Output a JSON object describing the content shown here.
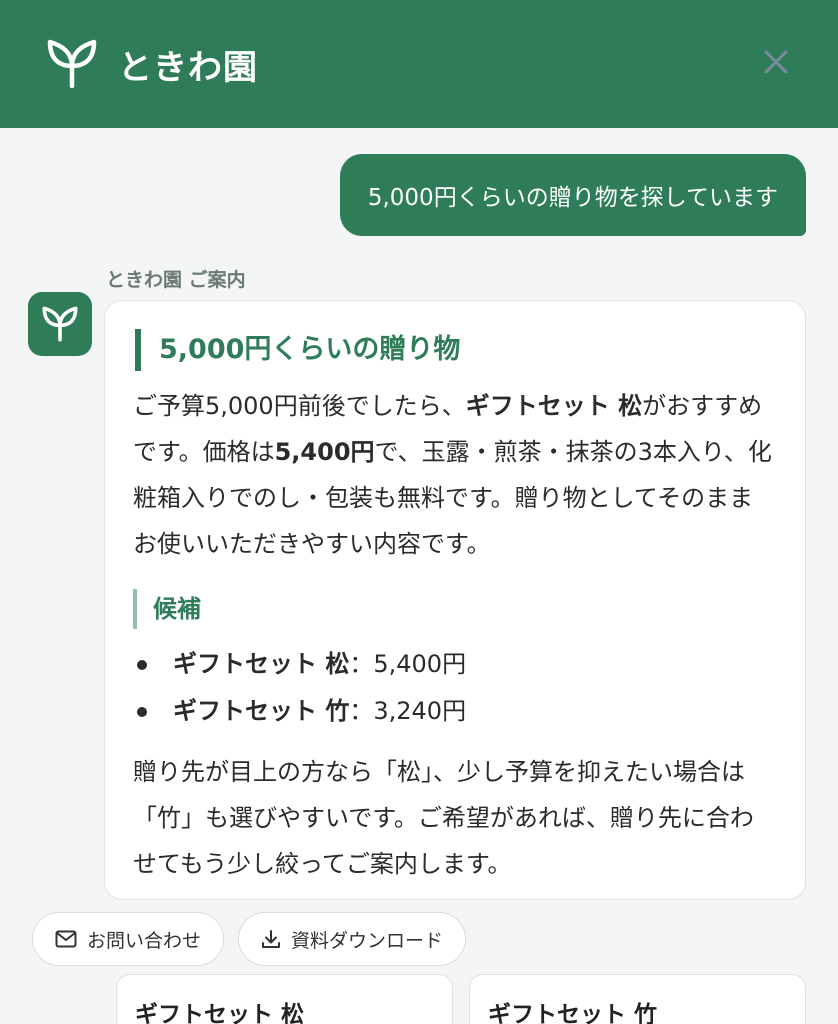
{
  "header": {
    "brand_name": "ときわ園",
    "logo_icon": "leaf-icon",
    "close_icon": "close-icon"
  },
  "colors": {
    "brand": "#2f7d58",
    "background": "#f4f6f5",
    "card": "#ffffff"
  },
  "chat": {
    "user_message": "5,000円くらいの贈り物を探しています",
    "bot_label": "ときわ園 ご案内",
    "bot_avatar_icon": "leaf-icon",
    "response": {
      "heading": "5,000円くらいの贈り物",
      "intro": {
        "t1": "ご予算5,000円前後でしたら、",
        "b1": "ギフトセット 松",
        "t2": "がおすすめです。価格は",
        "b2": "5,400円",
        "t3": "で、玉露・煎茶・抹茶の3本入り、化粧箱入りでのし・包装も無料です。贈り物としてそのままお使いいただきやすい内容です。"
      },
      "candidates_heading": "候補",
      "candidates": [
        {
          "name": "ギフトセット 松",
          "price": "：5,400円"
        },
        {
          "name": "ギフトセット 竹",
          "price": "：3,240円"
        }
      ],
      "closing": "贈り先が目上の方なら「松」、少し予算を抑えたい場合は「竹」も選びやすいです。ご希望があれば、贈り先に合わせてもう少し絞ってご案内します。"
    }
  },
  "actions": [
    {
      "label": "お問い合わせ",
      "icon": "mail-icon"
    },
    {
      "label": "資料ダウンロード",
      "icon": "download-icon"
    }
  ],
  "products": [
    {
      "name": "ギフトセット 松"
    },
    {
      "name": "ギフトセット 竹"
    }
  ]
}
